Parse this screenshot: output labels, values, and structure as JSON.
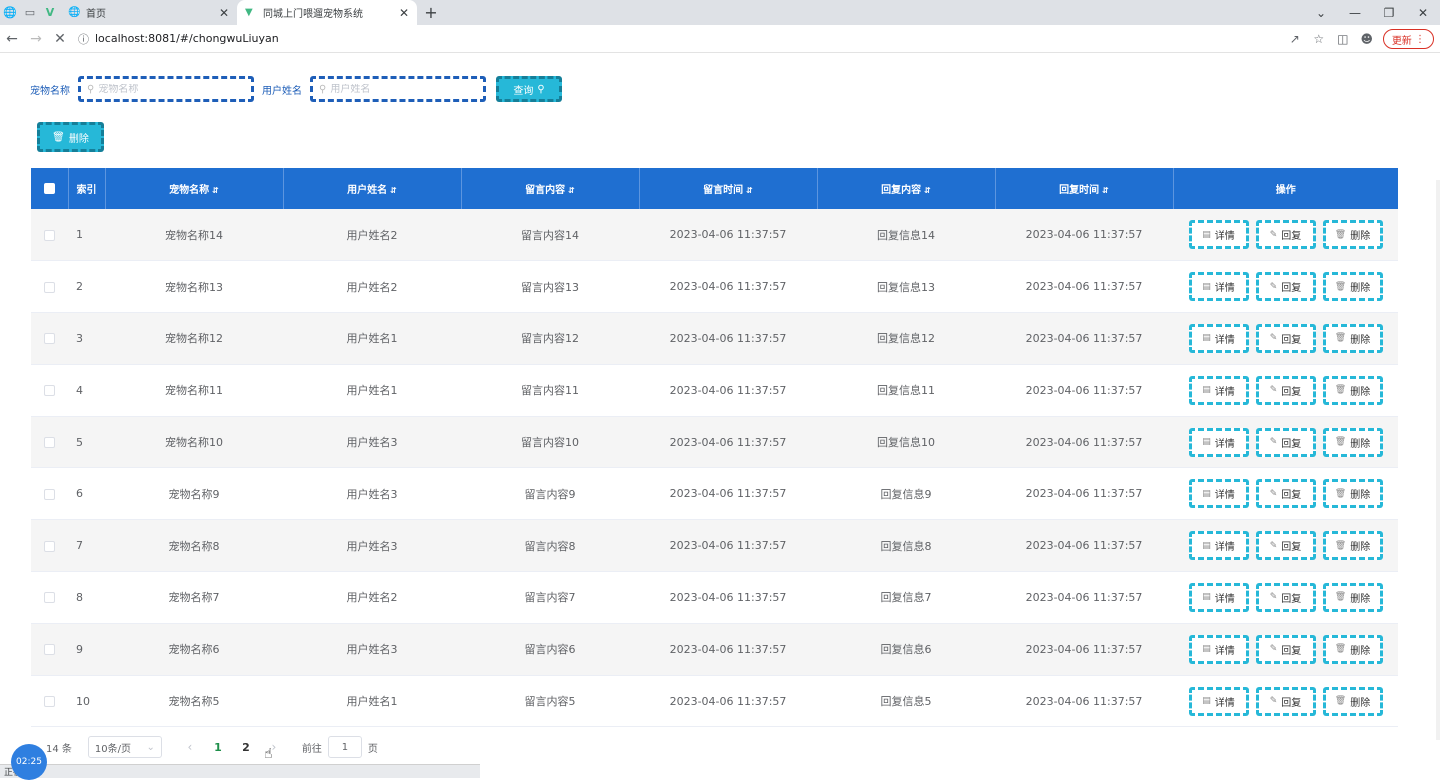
{
  "browser": {
    "tabs": [
      {
        "title": "首页",
        "active": false
      },
      {
        "title": "同城上门喂遛宠物系统",
        "active": true
      }
    ],
    "url": "localhost:8081/#/chongwuLiuyan",
    "update_label": "更新"
  },
  "search": {
    "pet_label": "宠物名称",
    "pet_placeholder": "宠物名称",
    "user_label": "用户姓名",
    "user_placeholder": "用户姓名",
    "query_label": "查询"
  },
  "toolbar": {
    "delete_label": "删除"
  },
  "table": {
    "headers": {
      "index": "索引",
      "pet": "宠物名称",
      "user": "用户姓名",
      "message": "留言内容",
      "msg_time": "留言时间",
      "reply": "回复内容",
      "reply_time": "回复时间",
      "ops": "操作"
    },
    "op_labels": {
      "detail": "详情",
      "reply": "回复",
      "delete": "删除"
    },
    "rows": [
      {
        "index": "1",
        "pet": "宠物名称14",
        "user": "用户姓名2",
        "message": "留言内容14",
        "msg_time": "2023-04-06 11:37:57",
        "reply": "回复信息14",
        "reply_time": "2023-04-06 11:37:57"
      },
      {
        "index": "2",
        "pet": "宠物名称13",
        "user": "用户姓名2",
        "message": "留言内容13",
        "msg_time": "2023-04-06 11:37:57",
        "reply": "回复信息13",
        "reply_time": "2023-04-06 11:37:57"
      },
      {
        "index": "3",
        "pet": "宠物名称12",
        "user": "用户姓名1",
        "message": "留言内容12",
        "msg_time": "2023-04-06 11:37:57",
        "reply": "回复信息12",
        "reply_time": "2023-04-06 11:37:57"
      },
      {
        "index": "4",
        "pet": "宠物名称11",
        "user": "用户姓名1",
        "message": "留言内容11",
        "msg_time": "2023-04-06 11:37:57",
        "reply": "回复信息11",
        "reply_time": "2023-04-06 11:37:57"
      },
      {
        "index": "5",
        "pet": "宠物名称10",
        "user": "用户姓名3",
        "message": "留言内容10",
        "msg_time": "2023-04-06 11:37:57",
        "reply": "回复信息10",
        "reply_time": "2023-04-06 11:37:57"
      },
      {
        "index": "6",
        "pet": "宠物名称9",
        "user": "用户姓名3",
        "message": "留言内容9",
        "msg_time": "2023-04-06 11:37:57",
        "reply": "回复信息9",
        "reply_time": "2023-04-06 11:37:57"
      },
      {
        "index": "7",
        "pet": "宠物名称8",
        "user": "用户姓名3",
        "message": "留言内容8",
        "msg_time": "2023-04-06 11:37:57",
        "reply": "回复信息8",
        "reply_time": "2023-04-06 11:37:57"
      },
      {
        "index": "8",
        "pet": "宠物名称7",
        "user": "用户姓名2",
        "message": "留言内容7",
        "msg_time": "2023-04-06 11:37:57",
        "reply": "回复信息7",
        "reply_time": "2023-04-06 11:37:57"
      },
      {
        "index": "9",
        "pet": "宠物名称6",
        "user": "用户姓名3",
        "message": "留言内容6",
        "msg_time": "2023-04-06 11:37:57",
        "reply": "回复信息6",
        "reply_time": "2023-04-06 11:37:57"
      },
      {
        "index": "10",
        "pet": "宠物名称5",
        "user": "用户姓名1",
        "message": "留言内容5",
        "msg_time": "2023-04-06 11:37:57",
        "reply": "回复信息5",
        "reply_time": "2023-04-06 11:37:57"
      }
    ]
  },
  "pagination": {
    "total_text": "14 条",
    "page_size": "10条/页",
    "pages": [
      "1",
      "2"
    ],
    "current_page": "1",
    "goto_prefix": "前往",
    "goto_value": "1",
    "goto_suffix": "页"
  },
  "overlay": {
    "timer": "02:25",
    "status_text": "正在..."
  },
  "colors": {
    "header_blue": "#1f6fd1",
    "accent_cyan": "#26b8d8",
    "label_blue": "#1e5eb8"
  },
  "icons": {
    "search": "search-icon",
    "delete": "trash-icon",
    "detail": "document-icon",
    "reply": "edit-icon",
    "sort": "sort-icon"
  }
}
